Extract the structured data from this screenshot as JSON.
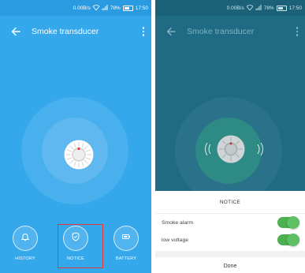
{
  "statusbar": {
    "speed": "0.00B/s",
    "battery": "78%",
    "time": "17:50"
  },
  "app": {
    "title": "Smoke transducer"
  },
  "tabs": [
    {
      "label": "HISTORY",
      "icon": "bell-icon"
    },
    {
      "label": "NOTICE",
      "icon": "shield-icon"
    },
    {
      "label": "BATTERY",
      "icon": "battery-icon"
    }
  ],
  "notice_sheet": {
    "title": "NOTICE",
    "rows": [
      {
        "label": "Smoke alarm",
        "enabled": true
      },
      {
        "label": "low voltage",
        "enabled": true
      }
    ],
    "done_label": "Done"
  },
  "colors": {
    "primary_blue": "#35a8ec",
    "dimmed_teal": "#1f6b83",
    "toggle_on": "#4caf50",
    "highlight_border": "#e53935",
    "alarm_red": "#e53935"
  }
}
